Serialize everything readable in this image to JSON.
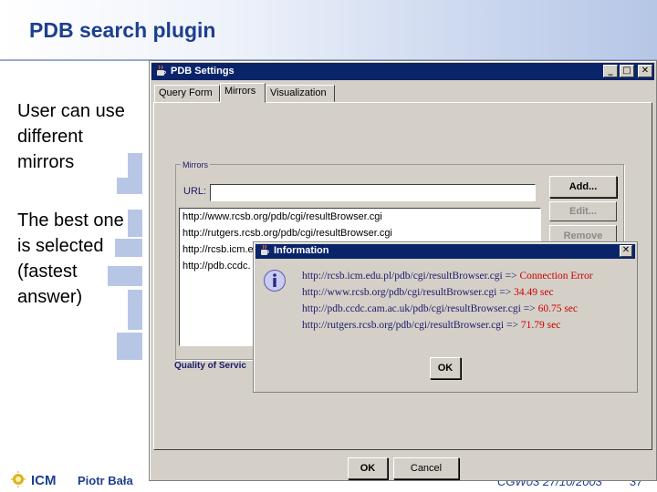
{
  "slide": {
    "title": "PDB search plugin",
    "bullets": [
      "User can use\ndifferent\nmirrors",
      "The best one\nis selected\n(fastest\nanswer)"
    ],
    "footer": {
      "logo": "ICM",
      "author": "Piotr Bała",
      "conference": "CGW03 27/10/2003",
      "page_number": "37"
    }
  },
  "settings_window": {
    "title": "PDB Settings",
    "controls": {
      "minimize": "_",
      "maximize": "□",
      "close": "✕"
    },
    "tabs": [
      {
        "label": "Query Form",
        "active": false
      },
      {
        "label": "Mirrors",
        "active": true
      },
      {
        "label": "Visualization",
        "active": false
      }
    ],
    "mirrors": {
      "group_label": "Mirrors",
      "url_label": "URL:",
      "url_value": "",
      "buttons": {
        "add": "Add...",
        "edit": "Edit...",
        "remove": "Remove"
      },
      "list": [
        "http://www.rcsb.org/pdb/cgi/resultBrowser.cgi",
        "http://rutgers.rcsb.org/pdb/cgi/resultBrowser.cgi",
        "http://rcsb.icm.e",
        "http://pdb.ccdc."
      ],
      "quality_label": "Quality of Servic"
    },
    "ok_button": "OK",
    "cancel_button": "Cancel"
  },
  "info_dialog": {
    "title": "Information",
    "icon": "info-icon",
    "messages": [
      {
        "url": "http://rcsb.icm.edu.pl/pdb/cgi/resultBrowser.cgi",
        "arrow": "=>",
        "result": "Connection Error"
      },
      {
        "url": "http://www.rcsb.org/pdb/cgi/resultBrowser.cgi",
        "arrow": "=>",
        "result": "34.49 sec"
      },
      {
        "url": "http://pdb.ccdc.cam.ac.uk/pdb/cgi/resultBrowser.cgi",
        "arrow": "=>",
        "result": "60.75 sec"
      },
      {
        "url": "http://rutgers.rcsb.org/pdb/cgi/resultBrowser.cgi",
        "arrow": "=>",
        "result": "71.79 sec"
      }
    ],
    "ok_button": "OK"
  },
  "colors": {
    "title_text": "#1d3f8f",
    "window_title": "#0a246a",
    "error_text": "#cc0000"
  }
}
